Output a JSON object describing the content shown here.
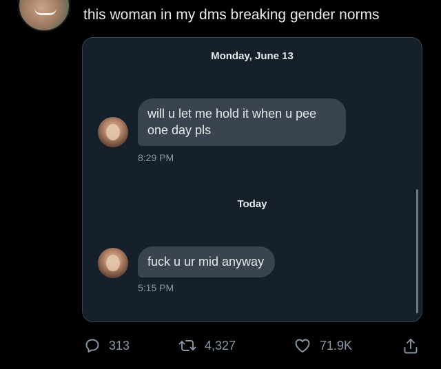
{
  "tweet": {
    "text": "this woman in my dms breaking gender norms"
  },
  "dm_screenshot": {
    "date_separator_1": "Monday, June 13",
    "message_1": "will u let me hold it when u pee one day pls",
    "message_1_time": "8:29 PM",
    "date_separator_2": "Today",
    "message_2": "fuck u ur mid anyway",
    "message_2_time": "5:15 PM"
  },
  "actions": {
    "replies": "313",
    "retweets": "4,327",
    "likes": "71.9K"
  },
  "icons": [
    "reply-icon",
    "retweet-icon",
    "like-icon",
    "share-icon"
  ],
  "colors": {
    "background": "#000000",
    "card": "#15202b",
    "bubble": "#3a4450",
    "muted_text": "#8b98a5"
  }
}
